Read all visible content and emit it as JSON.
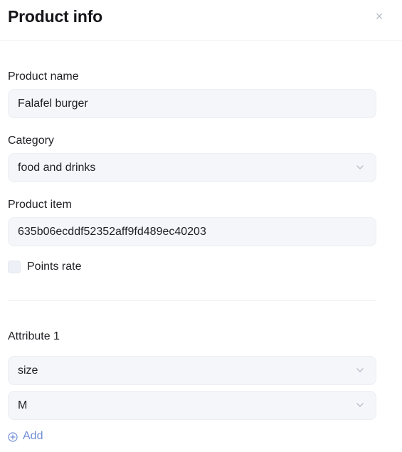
{
  "header": {
    "title": "Product info",
    "close_icon": "close-icon",
    "close_glyph": "×"
  },
  "form": {
    "product_name": {
      "label": "Product name",
      "value": "Falafel burger"
    },
    "category": {
      "label": "Category",
      "value": "food and drinks",
      "icon": "chevron-down-icon"
    },
    "product_item": {
      "label": "Product item",
      "value": "635b06ecddf52352aff9fd489ec40203"
    },
    "points_rate": {
      "label": "Points rate",
      "checked": false
    }
  },
  "attribute": {
    "label": "Attribute 1",
    "name_value": "size",
    "option_value": "M",
    "icon": "chevron-down-icon"
  },
  "add_button": {
    "label": "Add",
    "icon": "plus-circle-icon",
    "color": "#6f8bd6"
  },
  "colors": {
    "field_background": "#f5f6fa",
    "chevron": "#b7bcc8"
  }
}
